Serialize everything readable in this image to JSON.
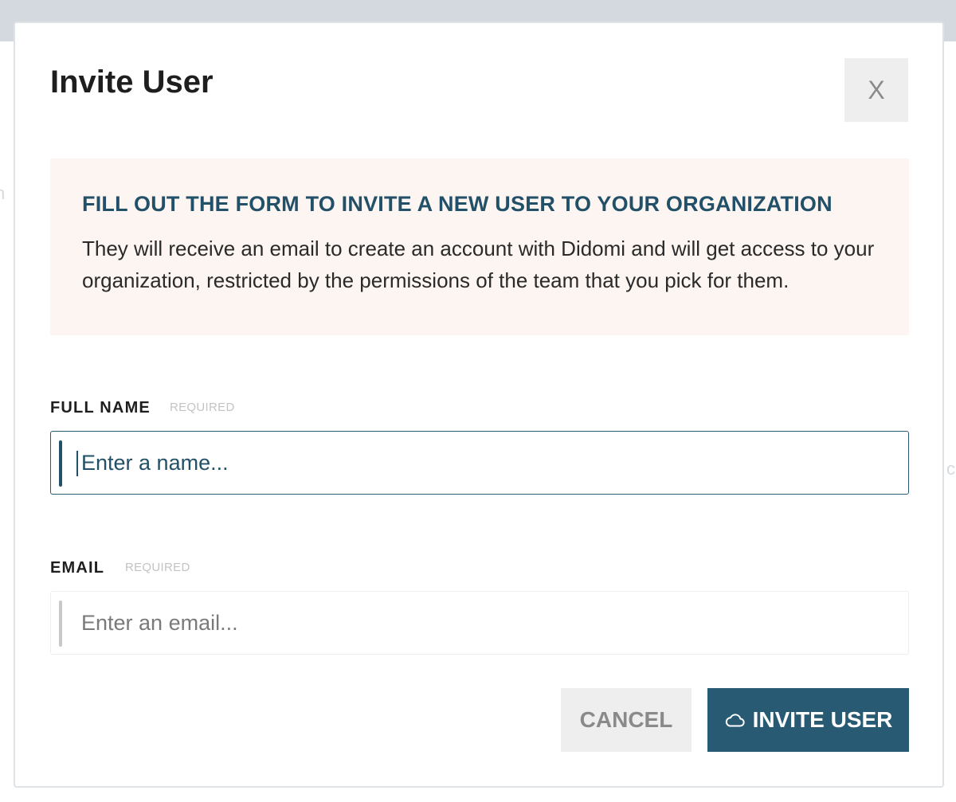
{
  "modal": {
    "title": "Invite User",
    "close_label": "X"
  },
  "notice": {
    "heading": "FILL OUT THE FORM TO INVITE A NEW USER TO YOUR ORGANIZATION",
    "body": "They will receive an email to create an account with Didomi and will get access to your organization, restricted by the permissions of the team that you pick for them."
  },
  "form": {
    "full_name": {
      "label": "FULL NAME",
      "required_tag": "REQUIRED",
      "value": "",
      "placeholder": "Enter a name..."
    },
    "email": {
      "label": "EMAIL",
      "required_tag": "REQUIRED",
      "value": "",
      "placeholder": "Enter an email..."
    }
  },
  "actions": {
    "cancel_label": "CANCEL",
    "invite_label": "INVITE USER",
    "invite_icon": "cloud-icon"
  },
  "colors": {
    "primary": "#285a74",
    "notice_bg": "#fdf5f1",
    "heading": "#225068"
  }
}
